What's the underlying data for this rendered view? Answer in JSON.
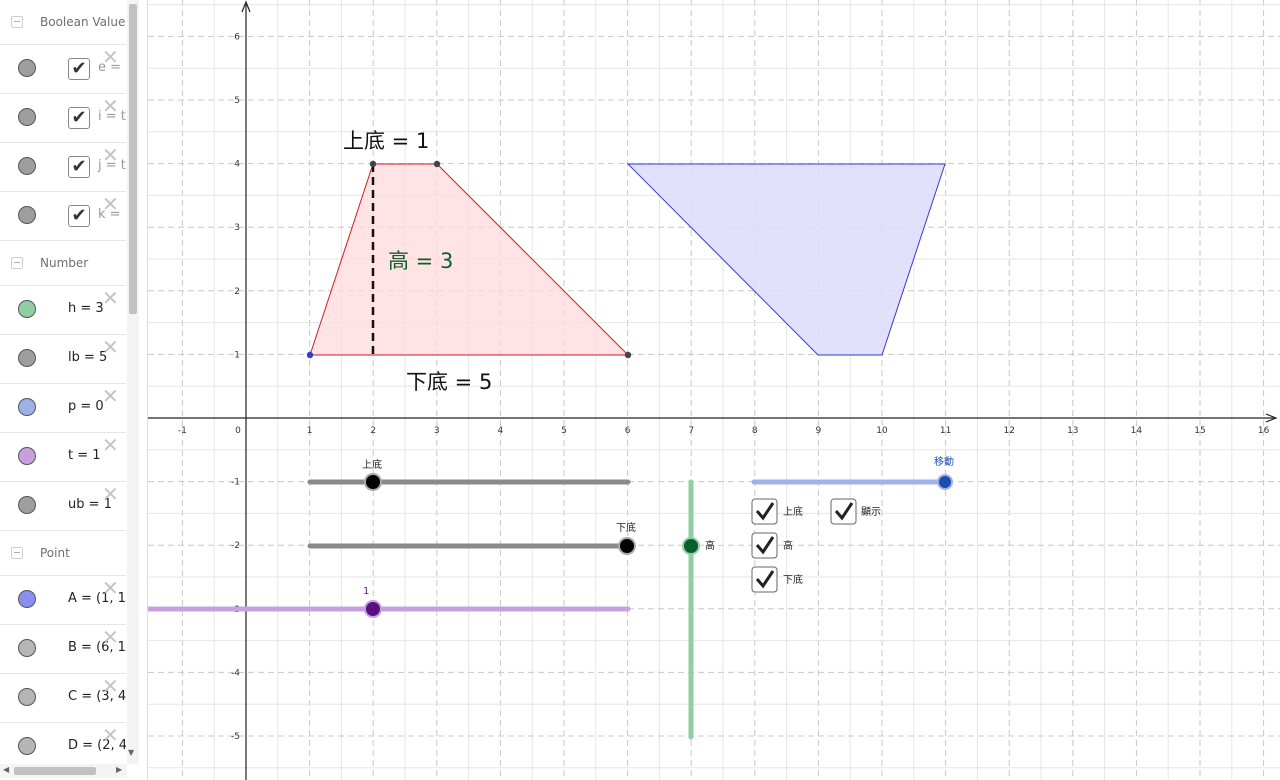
{
  "algebra_view": {
    "groups": [
      {
        "title": "Boolean Value",
        "items": [
          {
            "color": "#9e9e9e",
            "checked": true,
            "text": "e ="
          },
          {
            "color": "#9e9e9e",
            "checked": true,
            "text": "i = t"
          },
          {
            "color": "#9e9e9e",
            "checked": true,
            "text": "j = t"
          },
          {
            "color": "#9e9e9e",
            "checked": true,
            "text": "k ="
          }
        ]
      },
      {
        "title": "Number",
        "items": [
          {
            "color": "#8fcfa2",
            "text": "h = 3"
          },
          {
            "color": "#9e9e9e",
            "text": "lb = 5"
          },
          {
            "color": "#9fb2e8",
            "text": "p = 0"
          },
          {
            "color": "#c9a0df",
            "text": "t = 1"
          },
          {
            "color": "#9e9e9e",
            "text": "ub = 1"
          }
        ]
      },
      {
        "title": "Point",
        "items": [
          {
            "color": "#8a8ef0",
            "text": "A = (1, 1"
          },
          {
            "color": "#b5b5b5",
            "text": "B = (6, 1"
          },
          {
            "color": "#b5b5b5",
            "text": "C = (3, 4"
          },
          {
            "color": "#b5b5b5",
            "text": "D = (2, 4"
          }
        ]
      }
    ]
  },
  "graphics": {
    "x_ticks": [
      "-1",
      "0",
      "1",
      "2",
      "3",
      "4",
      "5",
      "6",
      "7",
      "8",
      "9",
      "10",
      "11",
      "12",
      "13",
      "14",
      "15",
      "16"
    ],
    "y_ticks": [
      "6",
      "5",
      "4",
      "3",
      "2",
      "1",
      "-1",
      "-2",
      "-3",
      "-4",
      "-5"
    ],
    "labels": {
      "top_base": "上底 = 1",
      "height": "高 = 3",
      "bottom_base": "下底 = 5"
    },
    "sliders": {
      "top_base_caption": "上底",
      "bottom_base_caption": "下底",
      "t_caption": "1",
      "height_caption": "高",
      "move_caption": "移動"
    },
    "checkboxes": [
      {
        "label": "上底",
        "checked": true
      },
      {
        "label": "顯示",
        "checked": true
      },
      {
        "label": "高",
        "checked": true
      },
      {
        "label": "下底",
        "checked": true
      }
    ],
    "colors": {
      "trapezoid_fill": "#ffd9dc",
      "trapezoid_stroke": "#d01c1c",
      "mirror_fill": "#dcdcfa",
      "mirror_stroke": "#3a3ad0",
      "height_label": "#0b5e2e",
      "move_slider": "#1e4db0",
      "t_slider": "#6a1b9a"
    }
  }
}
